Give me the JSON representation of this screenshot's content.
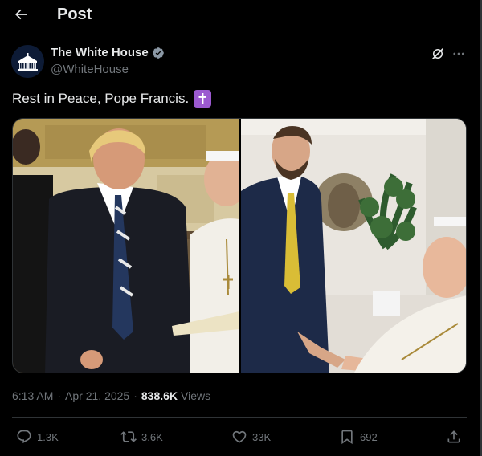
{
  "header": {
    "title": "Post"
  },
  "author": {
    "name": "The White House",
    "handle": "@WhiteHouse"
  },
  "post": {
    "text": "Rest in Peace, Pope Francis."
  },
  "meta": {
    "time": "6:13 AM",
    "date": "Apr 21, 2025",
    "views_count": "838.6K",
    "views_label": "Views"
  },
  "actions": {
    "replies": "1.3K",
    "reposts": "3.6K",
    "likes": "33K",
    "bookmarks": "692"
  },
  "colors": {
    "background": "#000000",
    "text": "#e7e9ea",
    "muted": "#71767b",
    "verified": "#8b98a5",
    "emoji_bg": "#9b59d0"
  },
  "icons": [
    "back-arrow-icon",
    "verified-badge-icon",
    "grok-icon",
    "more-icon",
    "cross-emoji-icon",
    "reply-icon",
    "repost-icon",
    "like-icon",
    "bookmark-icon",
    "share-icon"
  ]
}
